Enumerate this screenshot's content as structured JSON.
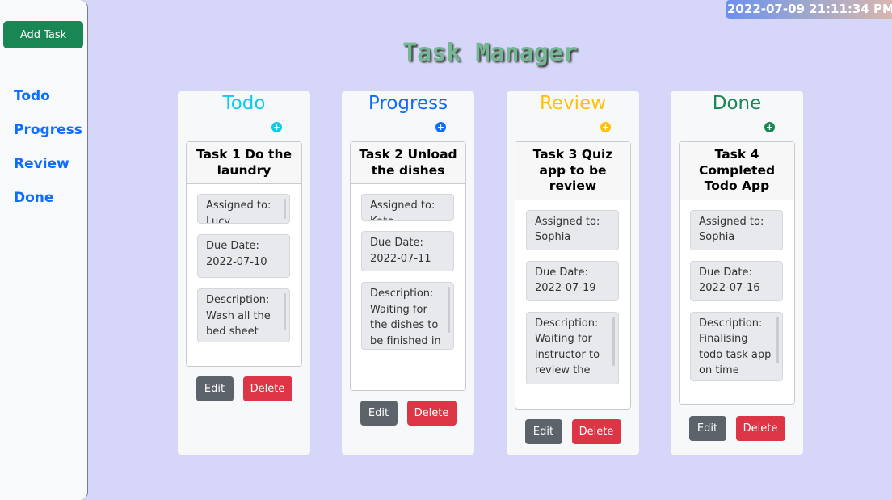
{
  "sidebar": {
    "add_task_label": "Add Task",
    "nav": [
      "Todo",
      "Progress",
      "Review",
      "Done"
    ]
  },
  "clock": "2022-07-09 21:11:34 PM",
  "title": "Task Manager",
  "buttons": {
    "edit": "Edit",
    "delete": "Delete"
  },
  "colors": {
    "todo": "#0dcaf0",
    "progress": "#0d6efd",
    "review": "#ffc107",
    "done": "#198754"
  },
  "columns": [
    {
      "title": "Todo",
      "add_icon": "plus-circle-icon",
      "task": {
        "title": "Task 1 Do the laundry",
        "assigned_label": "Assigned to:",
        "assigned": "Lucy",
        "due_label": "Due Date:",
        "due": "2022-07-10",
        "desc_label": "Description:",
        "desc": "Wash all the bed sheet"
      }
    },
    {
      "title": "Progress",
      "add_icon": "plus-circle-icon",
      "task": {
        "title": "Task 2 Unload the dishes",
        "assigned_label": "Assigned to:",
        "assigned": "Kate",
        "due_label": "Due Date:",
        "due": "2022-07-11",
        "desc_label": "Description:",
        "desc": "Waiting for the dishes to be finished in the"
      }
    },
    {
      "title": "Review",
      "add_icon": "plus-circle-icon",
      "task": {
        "title": "Task 3 Quiz app to be review",
        "assigned_label": "Assigned to:",
        "assigned": "Sophia",
        "due_label": "Due Date:",
        "due": "2022-07-19",
        "desc_label": "Description:",
        "desc": "Waiting for instructor to review the"
      }
    },
    {
      "title": "Done",
      "add_icon": "plus-circle-icon",
      "task": {
        "title": "Task 4 Completed Todo App",
        "assigned_label": "Assigned to:",
        "assigned": "Sophia",
        "due_label": "Due Date:",
        "due": "2022-07-16",
        "desc_label": "Description:",
        "desc": "Finalising todo task app on time"
      }
    }
  ]
}
